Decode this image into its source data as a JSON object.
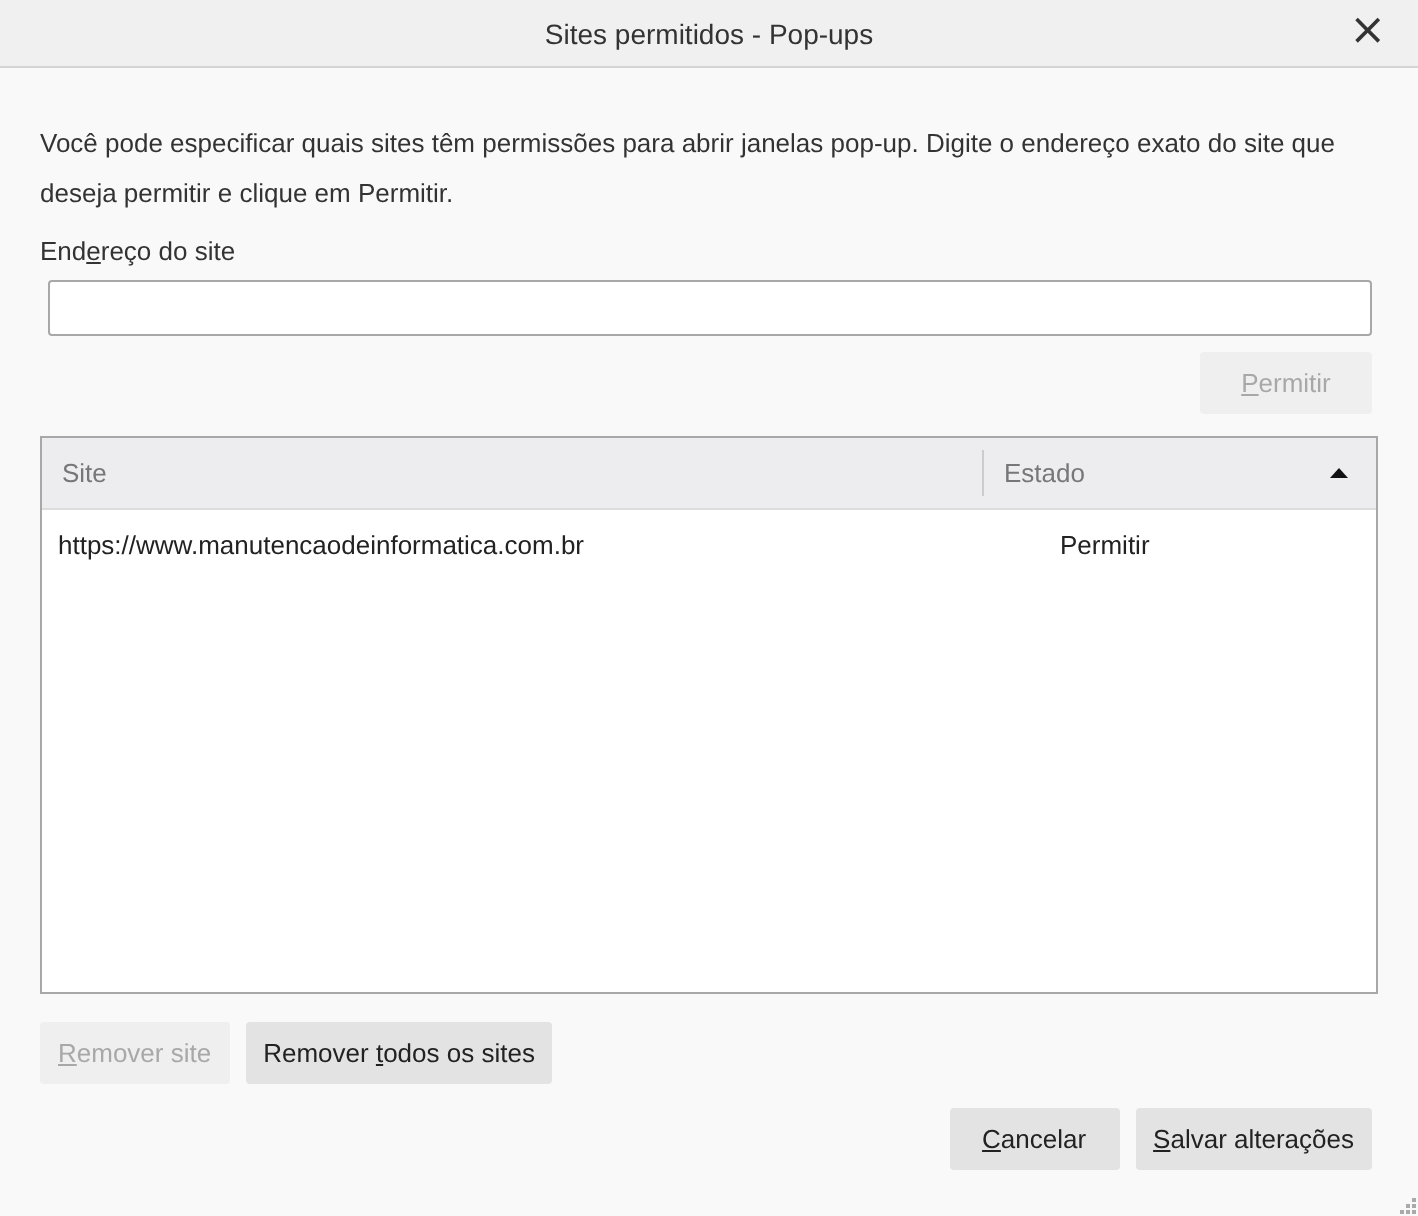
{
  "window": {
    "title": "Sites permitidos - Pop-ups",
    "close": "×"
  },
  "description": "Você pode especificar quais sites têm permissões para abrir janelas pop-up. Digite o endereço exato do site que deseja permitir e clique em Permitir.",
  "address_field": {
    "label_parts": [
      {
        "text": "End",
        "accesskey": false
      },
      {
        "text": "e",
        "accesskey": true
      },
      {
        "text": "reço do site",
        "accesskey": false
      }
    ]
  },
  "allow_button": {
    "label_parts": [
      {
        "text": "P",
        "accesskey": true
      },
      {
        "text": "ermitir",
        "accesskey": false
      }
    ],
    "disabled": true
  },
  "table": {
    "columns": [
      {
        "label": "Site",
        "sorted_ascending": false
      },
      {
        "label": "Estado",
        "sorted_ascending": true
      }
    ],
    "rows": [
      {
        "site": "https://www.manutencaodeinformatica.com.br",
        "status": "Permitir",
        "selected": false
      }
    ]
  },
  "list_buttons": [
    {
      "label_parts": [
        {
          "text": "R",
          "accesskey": true
        },
        {
          "text": "emover site",
          "accesskey": false
        }
      ],
      "disabled": true
    },
    {
      "label_parts": [
        {
          "text": "Remover ",
          "accesskey": false
        },
        {
          "text": "t",
          "accesskey": true
        },
        {
          "text": "odos os sites",
          "accesskey": false
        }
      ],
      "disabled": false
    }
  ],
  "dialog_buttons": [
    {
      "label_parts": [
        {
          "text": "C",
          "accesskey": true
        },
        {
          "text": "ancelar",
          "accesskey": false
        }
      ],
      "disabled": false
    },
    {
      "label_parts": [
        {
          "text": "S",
          "accesskey": true
        },
        {
          "text": "alvar alterações",
          "accesskey": false
        }
      ],
      "disabled": false
    }
  ]
}
